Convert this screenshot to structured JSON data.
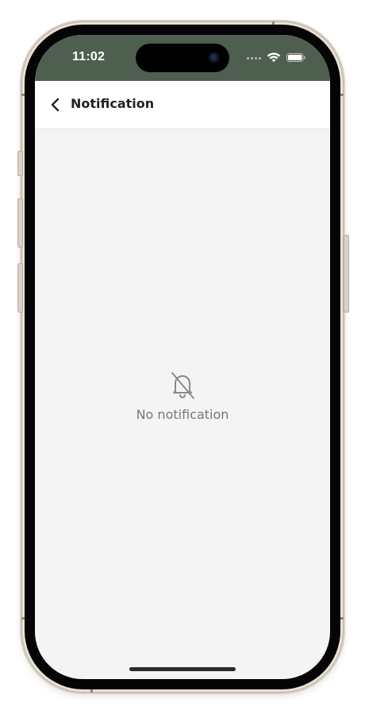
{
  "status_bar": {
    "time": "11:02",
    "background_color": "#4f5f4f",
    "icons": [
      "signal-dots-icon",
      "wifi-icon",
      "battery-icon"
    ]
  },
  "header": {
    "title": "Notification",
    "back_icon": "chevron-left-icon"
  },
  "empty_state": {
    "icon": "bell-off-icon",
    "message": "No notification"
  }
}
